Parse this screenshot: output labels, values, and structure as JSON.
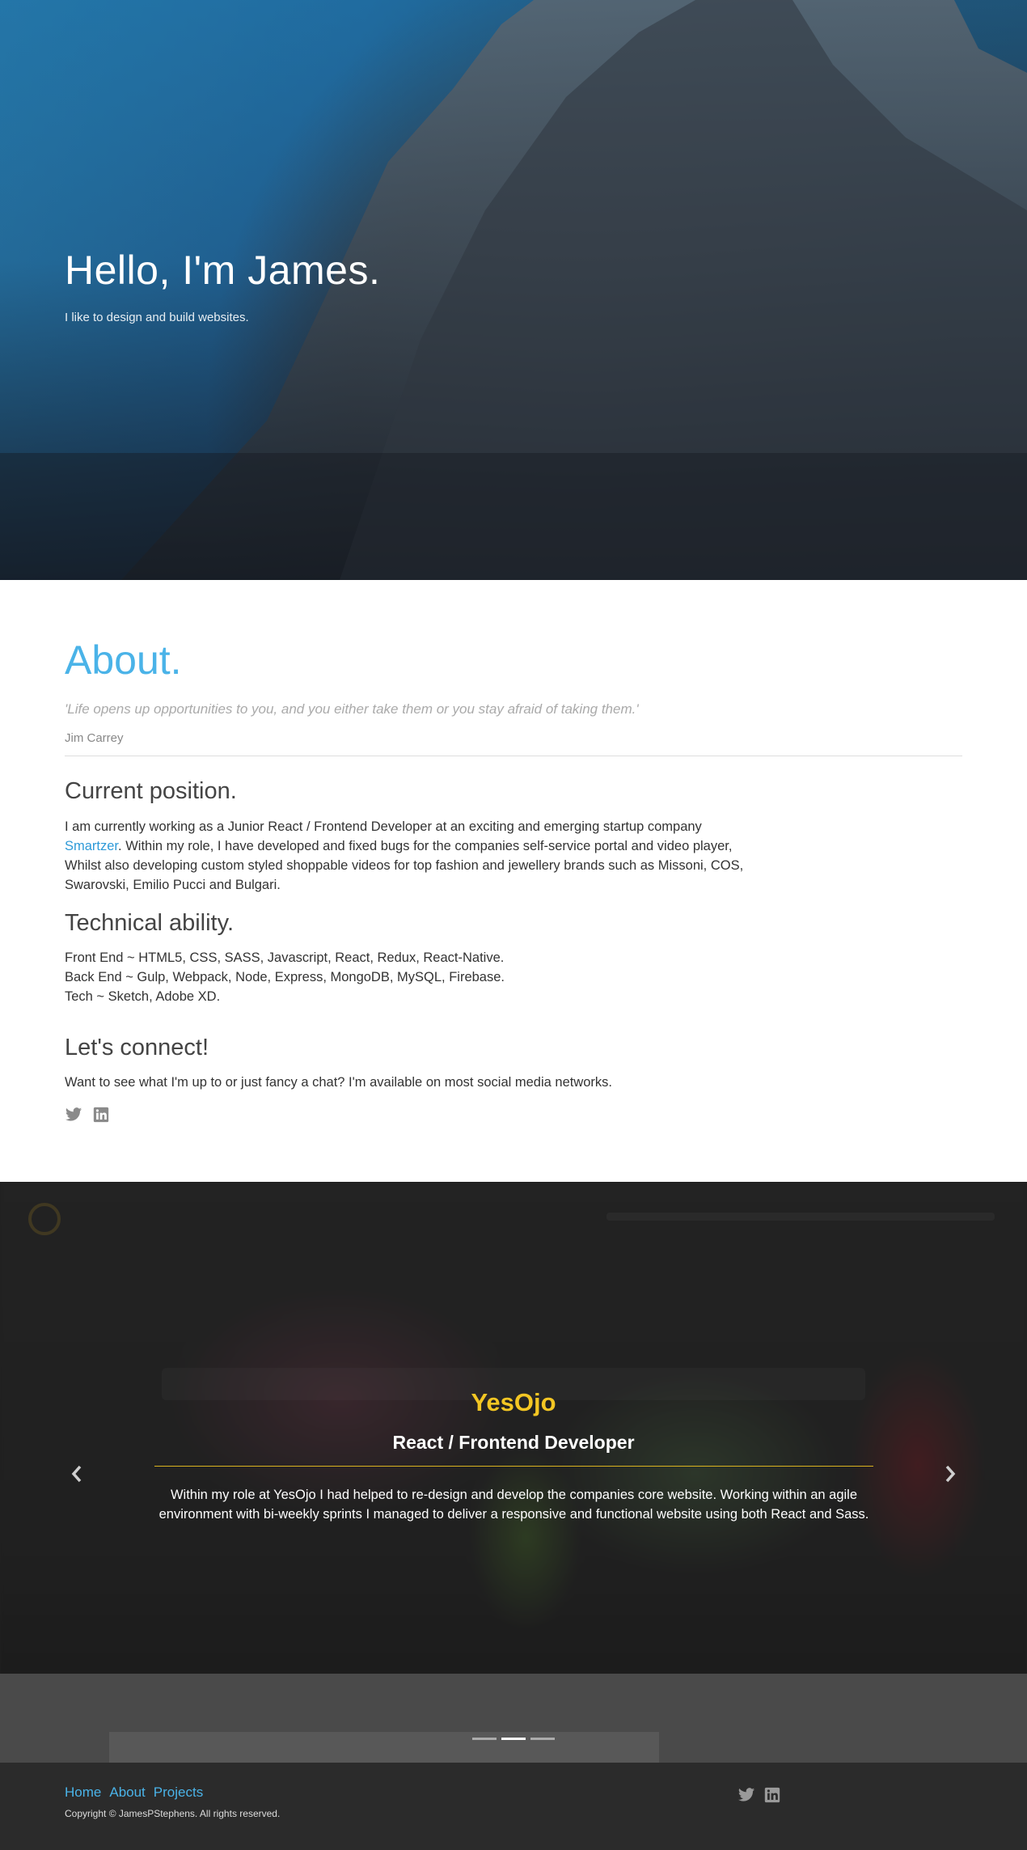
{
  "hero": {
    "title": "Hello, I'm James.",
    "subtitle": "I like to design and build websites."
  },
  "about": {
    "title": "About.",
    "quote": "'Life opens up opportunities to you, and you either take them or you stay afraid of taking them.'",
    "quote_author": "Jim Carrey",
    "current_position": {
      "heading": "Current position.",
      "text_before_link": "I am currently working as a Junior React / Frontend Developer at an exciting and emerging startup company ",
      "link_label": "Smartzer",
      "text_after_link": ". Within my role, I have developed and fixed bugs for the companies self-service portal and video player, Whilst also developing custom styled shoppable videos for top fashion and jewellery brands such as Missoni, COS, Swarovski, Emilio Pucci and Bulgari."
    },
    "technical": {
      "heading": "Technical ability.",
      "lines": [
        "Front End ~ HTML5, CSS, SASS, Javascript, React, Redux, React-Native.",
        "Back End ~ Gulp, Webpack, Node, Express, MongoDB, MySQL, Firebase.",
        "Tech ~ Sketch, Adobe XD."
      ]
    },
    "connect": {
      "heading": "Let's connect!",
      "text": "Want to see what I'm up to or just fancy a chat? I'm available on most social media networks.",
      "icons": [
        "twitter-icon",
        "linkedin-icon"
      ]
    }
  },
  "carousel": {
    "title": "YesOjo",
    "role": "React / Frontend Developer",
    "description": "Within my role at YesOjo I had helped to re-design and develop the companies core website. Working within an agile environment with bi-weekly sprints I managed to deliver a responsive and functional website using both React and Sass.",
    "prev_icon": "chevron-left-icon",
    "next_icon": "chevron-right-icon",
    "slide_count": 3,
    "active_slide": 2,
    "accent_color": "#f3c623"
  },
  "footer": {
    "nav": [
      "Home",
      "About",
      "Projects"
    ],
    "copyright": "Copyright © JamesPStephens. All rights reserved.",
    "icons": [
      "twitter-icon",
      "linkedin-icon"
    ]
  },
  "colors": {
    "accent_blue": "#4ab3e8",
    "footer_bg": "#2b2b2b"
  }
}
